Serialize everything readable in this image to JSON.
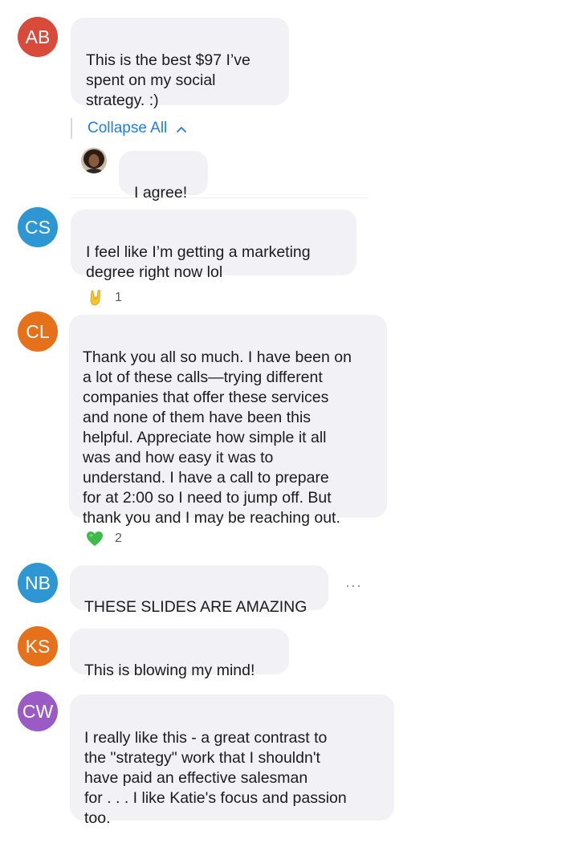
{
  "ui": {
    "accent_color": "#1f7cf0",
    "bubble_color": "#f1f1f6",
    "collapse_label": "Collapse All",
    "collapse_icon": "chevron-up-icon",
    "more_label": "···"
  },
  "messages": [
    {
      "initials": "AB",
      "avatar_color": "#d84a3a",
      "text": "This is the best $97 I’ve\nspent on my social\nstrategy. :)"
    },
    {
      "reply": true,
      "avatar_icon": "user-photo",
      "text": "I agree!"
    },
    {
      "initials": "CS",
      "avatar_color": "#2d96d3",
      "text": "I feel like I’m getting a marketing\ndegree right now lol",
      "reaction": {
        "emoji": "rock-on-hand-icon",
        "count": "1"
      }
    },
    {
      "initials": "CL",
      "avatar_color": "#e5711b",
      "text": "Thank you all so much. I have been on\na lot of these calls—trying different\ncompanies that offer these services\nand none of them have been this\nhelpful. Appreciate how simple it all\nwas and how easy it was to\nunderstand. I have a call to prepare\nfor at 2:00 so I need to jump off. But\nthank you and I may be reaching out.",
      "reaction": {
        "emoji": "green-heart-icon",
        "count": "2"
      }
    },
    {
      "initials": "NB",
      "avatar_color": "#2d96d3",
      "text": "THESE SLIDES ARE AMAZING"
    },
    {
      "initials": "KS",
      "avatar_color": "#e5711b",
      "text": "This is blowing my mind!"
    },
    {
      "initials": "CW",
      "avatar_color": "#9a5bc4",
      "text": "I really like this - a great contrast to\nthe \"strategy\" work that I shouldn't\nhave paid an effective salesman\nfor . . . I like Katie's focus and passion\ntoo."
    }
  ]
}
